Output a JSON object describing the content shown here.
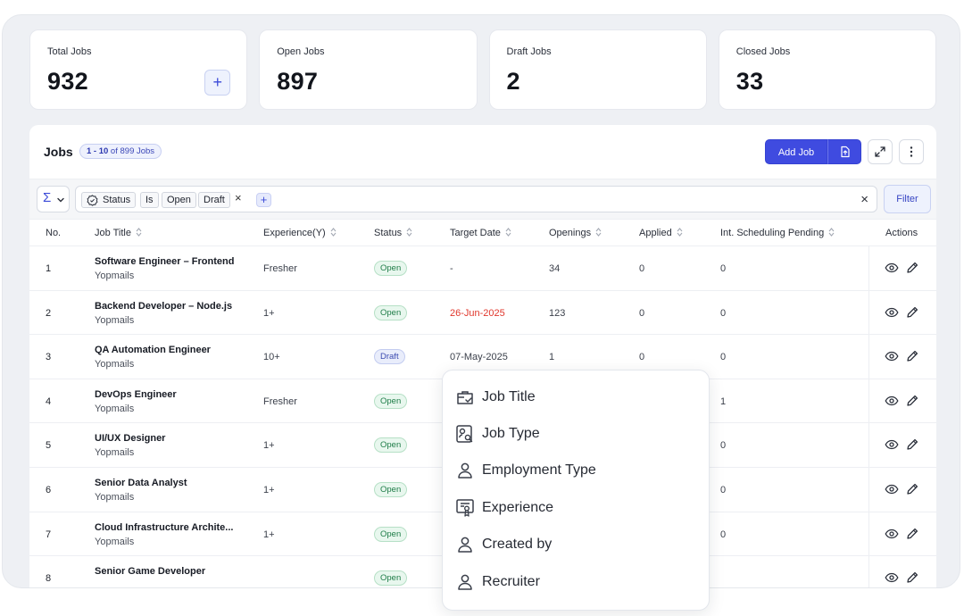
{
  "stats": [
    {
      "label": "Total Jobs",
      "value": "932",
      "add_label": "+"
    },
    {
      "label": "Open Jobs",
      "value": "897"
    },
    {
      "label": "Draft Jobs",
      "value": "2"
    },
    {
      "label": "Closed Jobs",
      "value": "33"
    }
  ],
  "jobs": {
    "title": "Jobs",
    "count_range": "1 - 10",
    "count_rest": " of 899 Jobs",
    "add_job_label": "Add Job"
  },
  "filter": {
    "sigma": "Σ",
    "chips": [
      "Status",
      "Is",
      "Open",
      "Draft"
    ],
    "remove": "×",
    "add": "+",
    "clear": "×",
    "button_label": "Filter"
  },
  "columns": {
    "no": "No.",
    "job_title": "Job Title",
    "experience": "Experience(Y)",
    "status": "Status",
    "target_date": "Target Date",
    "openings": "Openings",
    "applied": "Applied",
    "pending": "Int. Scheduling Pending",
    "actions": "Actions"
  },
  "rows": [
    {
      "no": "1",
      "title": "Software Engineer – Frontend",
      "company": "Yopmails",
      "exp": "Fresher",
      "status": "Open",
      "date": "-",
      "openings": "34",
      "applied": "0",
      "pending": "0"
    },
    {
      "no": "2",
      "title": "Backend Developer – Node.js",
      "company": "Yopmails",
      "exp": "1+",
      "status": "Open",
      "date": "26-Jun-2025",
      "overdue": true,
      "openings": "123",
      "applied": "0",
      "pending": "0"
    },
    {
      "no": "3",
      "title": "QA Automation Engineer",
      "company": "Yopmails",
      "exp": "10+",
      "status": "Draft",
      "date": "07-May-2025",
      "openings": "1",
      "applied": "0",
      "pending": "0"
    },
    {
      "no": "4",
      "title": "DevOps Engineer",
      "company": "Yopmails",
      "exp": "Fresher",
      "status": "Open",
      "date": "",
      "openings": "",
      "applied": "",
      "pending": "1"
    },
    {
      "no": "5",
      "title": "UI/UX Designer",
      "company": "Yopmails",
      "exp": "1+",
      "status": "Open",
      "date": "",
      "openings": "",
      "applied": "",
      "pending": "0"
    },
    {
      "no": "6",
      "title": "Senior Data Analyst",
      "company": "Yopmails",
      "exp": "1+",
      "status": "Open",
      "date": "",
      "openings": "",
      "applied": "",
      "pending": "0"
    },
    {
      "no": "7",
      "title": "Cloud Infrastructure Archite...",
      "company": "Yopmails",
      "exp": "1+",
      "status": "Open",
      "date": "",
      "openings": "",
      "applied": "",
      "pending": "0"
    },
    {
      "no": "8",
      "title": "Senior Game Developer",
      "company": "",
      "exp": "",
      "status": "Open",
      "date": "",
      "openings": "",
      "applied": "",
      "pending": ""
    }
  ],
  "dropdown": [
    {
      "label": "Job Title",
      "icon": "briefcase-check-icon"
    },
    {
      "label": "Job Type",
      "icon": "id-badge-search-icon"
    },
    {
      "label": "Employment Type",
      "icon": "user-icon"
    },
    {
      "label": "Experience",
      "icon": "certificate-icon"
    },
    {
      "label": "Created by",
      "icon": "user-icon"
    },
    {
      "label": "Recruiter",
      "icon": "user-icon"
    }
  ],
  "colors": {
    "primary": "#3f4be0",
    "overdue": "#e0372c",
    "open_badge": "#1f7d48",
    "draft_badge": "#3b4ab0"
  }
}
